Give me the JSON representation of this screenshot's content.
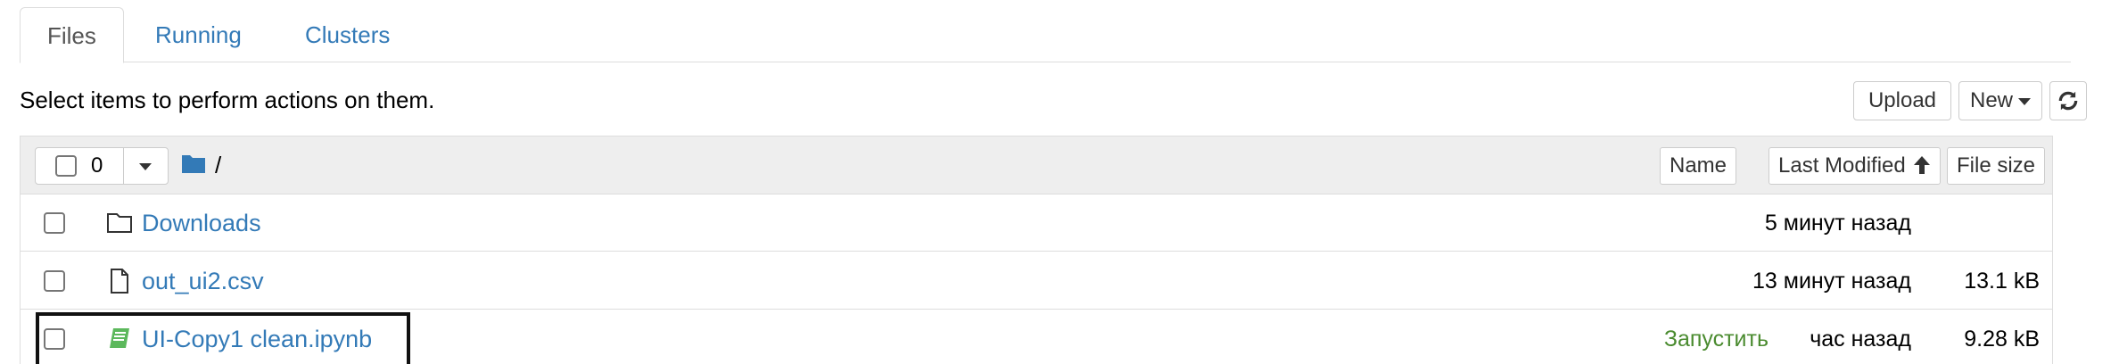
{
  "tabs": [
    {
      "label": "Files",
      "active": true
    },
    {
      "label": "Running",
      "active": false
    },
    {
      "label": "Clusters",
      "active": false
    }
  ],
  "toolbar": {
    "hint": "Select items to perform actions on them.",
    "upload_label": "Upload",
    "new_label": "New",
    "refresh_icon": "refresh-icon"
  },
  "list_header": {
    "selected_count": "0",
    "breadcrumb_root": "/",
    "sort_name": "Name",
    "sort_modified": "Last Modified",
    "sort_size": "File size"
  },
  "files": [
    {
      "name": "Downloads",
      "type": "folder",
      "icon": "folder-icon",
      "modified": "5 минут назад",
      "size": "",
      "running": ""
    },
    {
      "name": "out_ui2.csv",
      "type": "file",
      "icon": "file-icon",
      "modified": "13 минут назад",
      "size": "13.1 kB",
      "running": ""
    },
    {
      "name": "UI-Copy1 clean.ipynb",
      "type": "notebook",
      "icon": "notebook-icon",
      "modified": "час назад",
      "size": "9.28 kB",
      "running": "Запустить"
    }
  ],
  "colors": {
    "link": "#337ab7",
    "running": "#4a8b2f",
    "header_bg": "#eeeeee",
    "border": "#dddddd"
  }
}
